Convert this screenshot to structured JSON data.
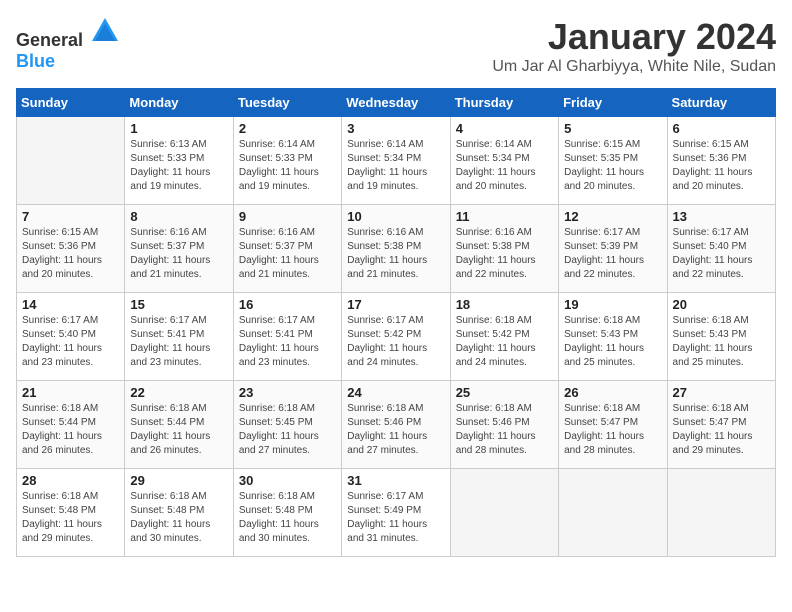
{
  "header": {
    "logo_general": "General",
    "logo_blue": "Blue",
    "title": "January 2024",
    "subtitle": "Um Jar Al Gharbiyya, White Nile, Sudan"
  },
  "weekdays": [
    "Sunday",
    "Monday",
    "Tuesday",
    "Wednesday",
    "Thursday",
    "Friday",
    "Saturday"
  ],
  "weeks": [
    [
      {
        "day": "",
        "empty": true
      },
      {
        "day": "1",
        "sunrise": "6:13 AM",
        "sunset": "5:33 PM",
        "daylight": "11 hours and 19 minutes."
      },
      {
        "day": "2",
        "sunrise": "6:14 AM",
        "sunset": "5:33 PM",
        "daylight": "11 hours and 19 minutes."
      },
      {
        "day": "3",
        "sunrise": "6:14 AM",
        "sunset": "5:34 PM",
        "daylight": "11 hours and 19 minutes."
      },
      {
        "day": "4",
        "sunrise": "6:14 AM",
        "sunset": "5:34 PM",
        "daylight": "11 hours and 20 minutes."
      },
      {
        "day": "5",
        "sunrise": "6:15 AM",
        "sunset": "5:35 PM",
        "daylight": "11 hours and 20 minutes."
      },
      {
        "day": "6",
        "sunrise": "6:15 AM",
        "sunset": "5:36 PM",
        "daylight": "11 hours and 20 minutes."
      }
    ],
    [
      {
        "day": "7",
        "sunrise": "6:15 AM",
        "sunset": "5:36 PM",
        "daylight": "11 hours and 20 minutes."
      },
      {
        "day": "8",
        "sunrise": "6:16 AM",
        "sunset": "5:37 PM",
        "daylight": "11 hours and 21 minutes."
      },
      {
        "day": "9",
        "sunrise": "6:16 AM",
        "sunset": "5:37 PM",
        "daylight": "11 hours and 21 minutes."
      },
      {
        "day": "10",
        "sunrise": "6:16 AM",
        "sunset": "5:38 PM",
        "daylight": "11 hours and 21 minutes."
      },
      {
        "day": "11",
        "sunrise": "6:16 AM",
        "sunset": "5:38 PM",
        "daylight": "11 hours and 22 minutes."
      },
      {
        "day": "12",
        "sunrise": "6:17 AM",
        "sunset": "5:39 PM",
        "daylight": "11 hours and 22 minutes."
      },
      {
        "day": "13",
        "sunrise": "6:17 AM",
        "sunset": "5:40 PM",
        "daylight": "11 hours and 22 minutes."
      }
    ],
    [
      {
        "day": "14",
        "sunrise": "6:17 AM",
        "sunset": "5:40 PM",
        "daylight": "11 hours and 23 minutes."
      },
      {
        "day": "15",
        "sunrise": "6:17 AM",
        "sunset": "5:41 PM",
        "daylight": "11 hours and 23 minutes."
      },
      {
        "day": "16",
        "sunrise": "6:17 AM",
        "sunset": "5:41 PM",
        "daylight": "11 hours and 23 minutes."
      },
      {
        "day": "17",
        "sunrise": "6:17 AM",
        "sunset": "5:42 PM",
        "daylight": "11 hours and 24 minutes."
      },
      {
        "day": "18",
        "sunrise": "6:18 AM",
        "sunset": "5:42 PM",
        "daylight": "11 hours and 24 minutes."
      },
      {
        "day": "19",
        "sunrise": "6:18 AM",
        "sunset": "5:43 PM",
        "daylight": "11 hours and 25 minutes."
      },
      {
        "day": "20",
        "sunrise": "6:18 AM",
        "sunset": "5:43 PM",
        "daylight": "11 hours and 25 minutes."
      }
    ],
    [
      {
        "day": "21",
        "sunrise": "6:18 AM",
        "sunset": "5:44 PM",
        "daylight": "11 hours and 26 minutes."
      },
      {
        "day": "22",
        "sunrise": "6:18 AM",
        "sunset": "5:44 PM",
        "daylight": "11 hours and 26 minutes."
      },
      {
        "day": "23",
        "sunrise": "6:18 AM",
        "sunset": "5:45 PM",
        "daylight": "11 hours and 27 minutes."
      },
      {
        "day": "24",
        "sunrise": "6:18 AM",
        "sunset": "5:46 PM",
        "daylight": "11 hours and 27 minutes."
      },
      {
        "day": "25",
        "sunrise": "6:18 AM",
        "sunset": "5:46 PM",
        "daylight": "11 hours and 28 minutes."
      },
      {
        "day": "26",
        "sunrise": "6:18 AM",
        "sunset": "5:47 PM",
        "daylight": "11 hours and 28 minutes."
      },
      {
        "day": "27",
        "sunrise": "6:18 AM",
        "sunset": "5:47 PM",
        "daylight": "11 hours and 29 minutes."
      }
    ],
    [
      {
        "day": "28",
        "sunrise": "6:18 AM",
        "sunset": "5:48 PM",
        "daylight": "11 hours and 29 minutes."
      },
      {
        "day": "29",
        "sunrise": "6:18 AM",
        "sunset": "5:48 PM",
        "daylight": "11 hours and 30 minutes."
      },
      {
        "day": "30",
        "sunrise": "6:18 AM",
        "sunset": "5:48 PM",
        "daylight": "11 hours and 30 minutes."
      },
      {
        "day": "31",
        "sunrise": "6:17 AM",
        "sunset": "5:49 PM",
        "daylight": "11 hours and 31 minutes."
      },
      {
        "day": "",
        "empty": true
      },
      {
        "day": "",
        "empty": true
      },
      {
        "day": "",
        "empty": true
      }
    ]
  ]
}
